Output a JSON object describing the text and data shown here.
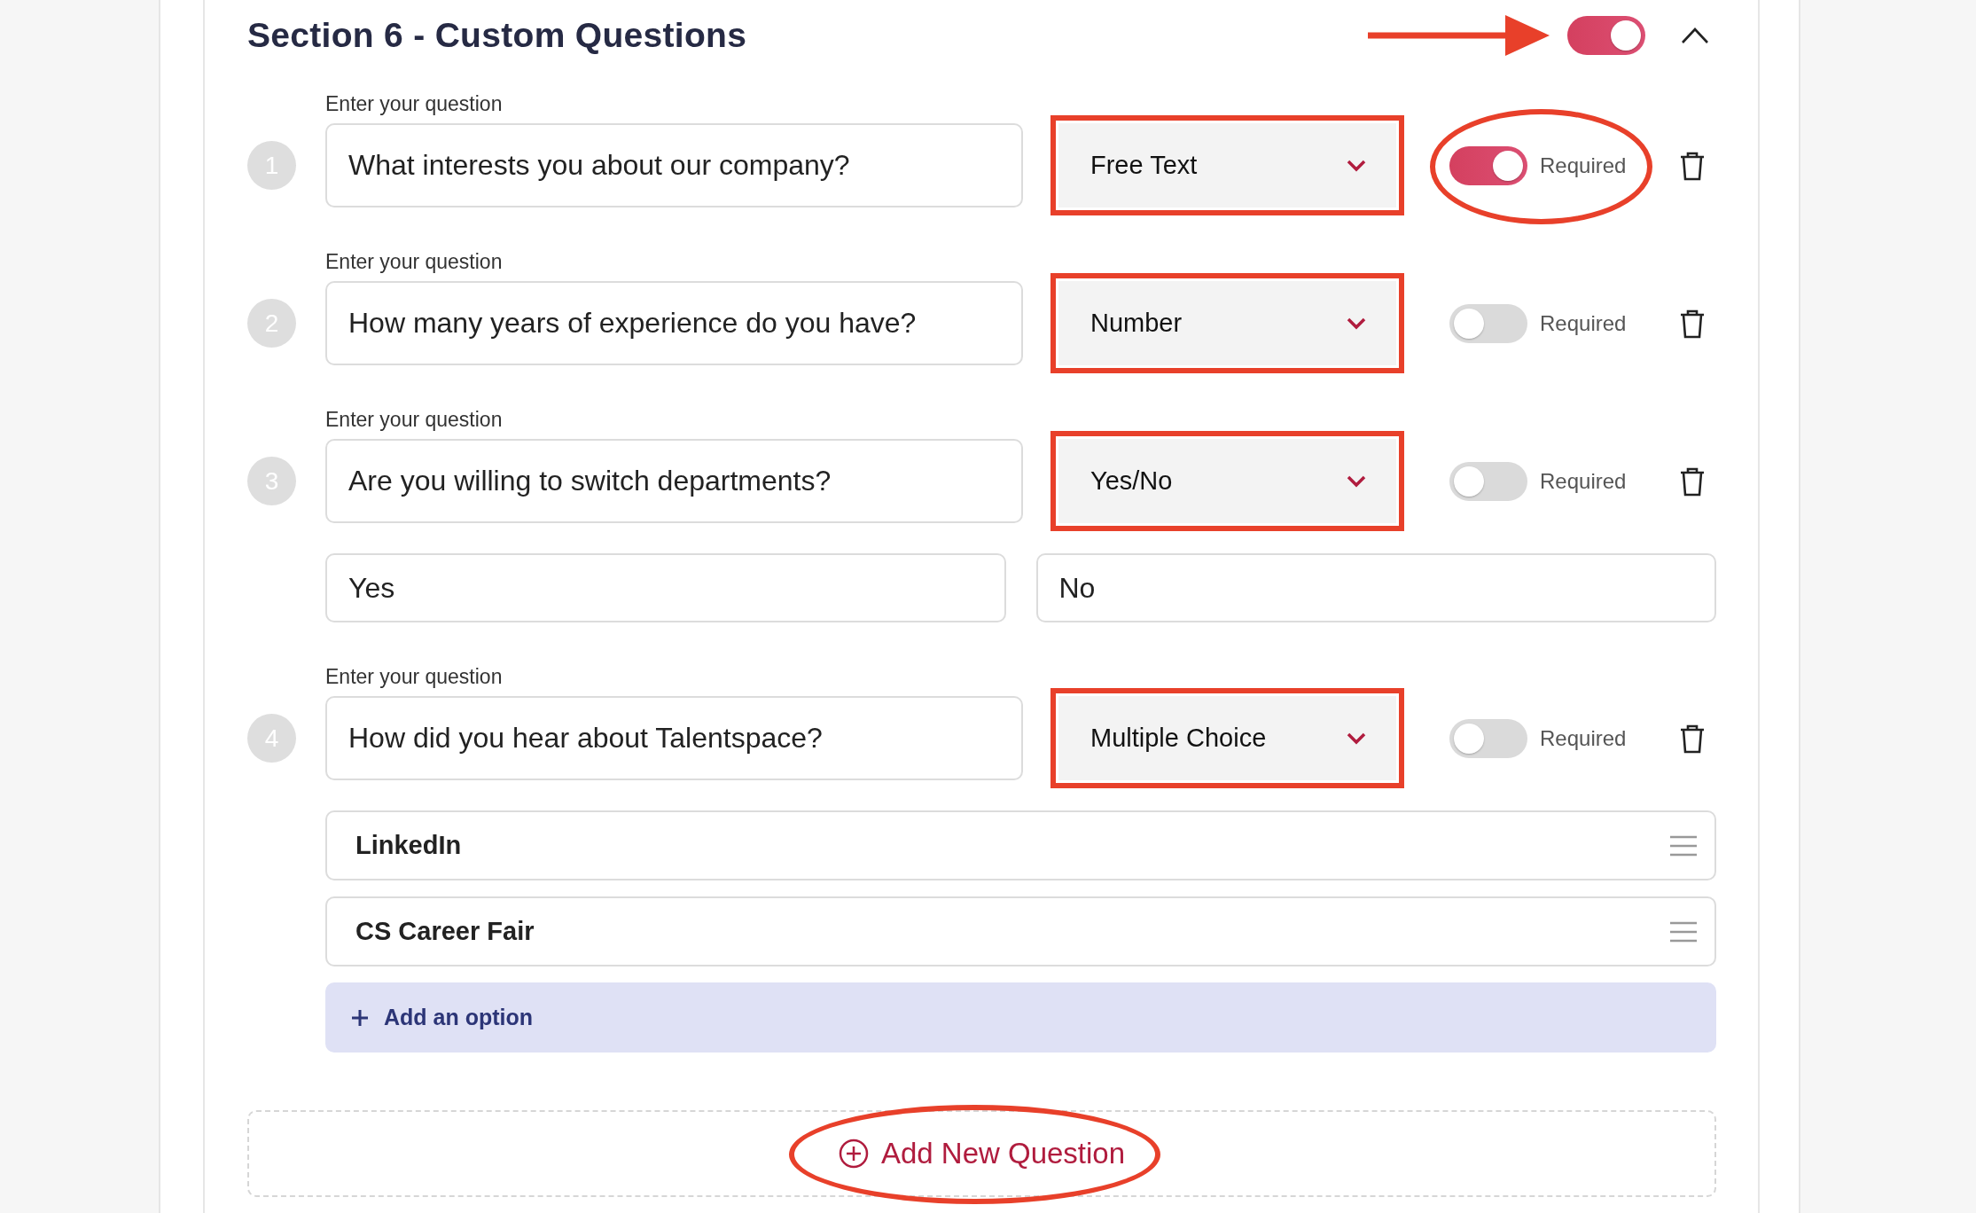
{
  "section": {
    "title": "Section 6 - Custom Questions",
    "enabled": true,
    "expanded": true,
    "arrow_annotation": true
  },
  "questions": [
    {
      "kind": "text",
      "number": "1",
      "label": "Enter your question",
      "value": "What interests you about our company?",
      "type": "Free Text",
      "type_highlighted": true,
      "required": true,
      "required_circled": true,
      "required_label": "Required"
    },
    {
      "kind": "text",
      "number": "2",
      "label": "Enter your question",
      "value": "How many years of experience do you have?",
      "type": "Number",
      "type_highlighted": true,
      "required": false,
      "required_circled": false,
      "required_label": "Required"
    },
    {
      "kind": "yes_no",
      "number": "3",
      "label": "Enter your question",
      "value": "Are you willing to switch departments?",
      "type": "Yes/No",
      "type_highlighted": true,
      "required": false,
      "required_circled": false,
      "required_label": "Required",
      "answers": [
        {
          "value": "Yes"
        },
        {
          "value": "No"
        }
      ]
    },
    {
      "kind": "choice",
      "number": "4",
      "label": "Enter your question",
      "value": "How did you hear about Talentspace?",
      "type": "Multiple Choice",
      "type_highlighted": true,
      "required": false,
      "required_circled": false,
      "required_label": "Required",
      "options": [
        {
          "label": "LinkedIn"
        },
        {
          "label": "CS Career Fair"
        }
      ],
      "add_option": "Add an option"
    }
  ],
  "add_question": {
    "label": "Add New Question",
    "circled": true
  }
}
